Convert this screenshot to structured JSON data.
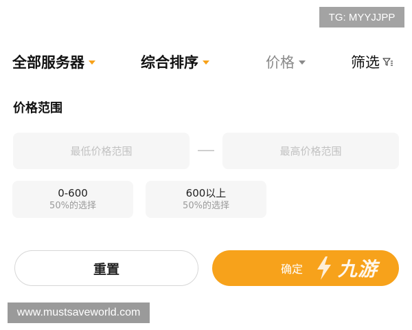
{
  "watermark_top": "TG: MYYJJPP",
  "watermark_bottom": "www.mustsaveworld.com",
  "filter_bar": {
    "server": "全部服务器",
    "sort": "综合排序",
    "price": "价格",
    "filter": "筛选"
  },
  "price_range": {
    "title": "价格范围",
    "min_placeholder": "最低价格范围",
    "max_placeholder": "最高价格范围",
    "min_value": "",
    "max_value": ""
  },
  "chips": [
    {
      "label": "0-600",
      "sub": "50%的选择"
    },
    {
      "label": "600以上",
      "sub": "50%的选择"
    }
  ],
  "actions": {
    "reset": "重置",
    "confirm": "确定"
  },
  "logo_text": "九游",
  "colors": {
    "accent": "#f7a21b",
    "input_bg": "#f6f6f6",
    "muted": "#8a8a8a"
  }
}
